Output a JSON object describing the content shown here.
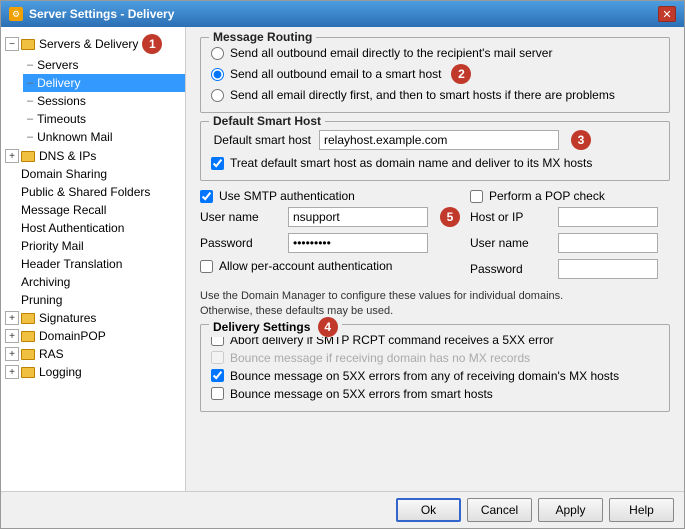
{
  "window": {
    "title": "Server Settings - Delivery",
    "icon": "⚙"
  },
  "sidebar": {
    "sections": [
      {
        "id": "servers-delivery",
        "label": "Servers & Delivery",
        "expanded": true,
        "badge": "1",
        "children": [
          {
            "id": "servers",
            "label": "Servers"
          },
          {
            "id": "delivery",
            "label": "Delivery",
            "selected": true
          },
          {
            "id": "sessions",
            "label": "Sessions"
          },
          {
            "id": "timeouts",
            "label": "Timeouts"
          },
          {
            "id": "unknown-mail",
            "label": "Unknown Mail"
          }
        ]
      },
      {
        "id": "dns-ips",
        "label": "DNS & IPs",
        "expanded": false
      },
      {
        "id": "domain-sharing",
        "label": "Domain Sharing",
        "expanded": false,
        "noExpand": true
      },
      {
        "id": "public-shared-folders",
        "label": "Public & Shared Folders",
        "expanded": false,
        "noExpand": true
      },
      {
        "id": "message-recall",
        "label": "Message Recall",
        "expanded": false,
        "noExpand": true
      },
      {
        "id": "host-authentication",
        "label": "Host Authentication",
        "expanded": false,
        "noExpand": true
      },
      {
        "id": "priority-mail",
        "label": "Priority Mail",
        "expanded": false,
        "noExpand": true
      },
      {
        "id": "header-translation",
        "label": "Header Translation",
        "expanded": false,
        "noExpand": true
      },
      {
        "id": "archiving",
        "label": "Archiving",
        "expanded": false,
        "noExpand": true
      },
      {
        "id": "pruning",
        "label": "Pruning",
        "expanded": false,
        "noExpand": true
      },
      {
        "id": "signatures",
        "label": "Signatures",
        "expanded": false
      },
      {
        "id": "domainpop",
        "label": "DomainPOP",
        "expanded": false
      },
      {
        "id": "ras",
        "label": "RAS",
        "expanded": false
      },
      {
        "id": "logging",
        "label": "Logging",
        "expanded": false
      }
    ]
  },
  "main": {
    "message_routing": {
      "label": "Message Routing",
      "options": [
        {
          "id": "direct",
          "label": "Send all outbound email directly to the recipient's mail server",
          "checked": false
        },
        {
          "id": "smart",
          "label": "Send all outbound email to a smart host",
          "checked": true,
          "badge": "2"
        },
        {
          "id": "smart-fallback",
          "label": "Send all email directly first, and then to smart hosts if there are problems",
          "checked": false
        }
      ]
    },
    "default_smart_host": {
      "label": "Default Smart Host",
      "field_label": "Default smart host",
      "value": "relayhost.example.com",
      "badge": "3",
      "checkbox_label": "Treat default smart host as domain name and deliver to its MX hosts",
      "checkbox_checked": true
    },
    "smtp_auth": {
      "use_smtp_label": "Use SMTP authentication",
      "use_smtp_checked": true,
      "user_name_label": "User name",
      "user_name_value": "nsupport",
      "password_label": "Password",
      "password_value": "••••••••",
      "allow_per_account_label": "Allow per-account authentication",
      "allow_per_account_checked": false,
      "badge": "5",
      "perform_pop_label": "Perform a POP check",
      "perform_pop_checked": false,
      "host_or_ip_label": "Host or IP",
      "host_or_ip_value": "",
      "user_name_right_label": "User name",
      "user_name_right_value": "",
      "password_right_label": "Password",
      "password_right_value": ""
    },
    "info_text": "Use the Domain Manager to configure these values for individual domains.\nOtherwise, these defaults may be used.",
    "delivery_settings": {
      "label": "Delivery Settings",
      "badge": "4",
      "options": [
        {
          "id": "abort",
          "label": "Abort delivery if SMTP RCPT command receives a  5XX error",
          "checked": false
        },
        {
          "id": "bounce-no-mx",
          "label": "Bounce message if receiving domain has no MX records",
          "checked": false,
          "disabled": true
        },
        {
          "id": "bounce-mx",
          "label": "Bounce message on 5XX errors from any of receiving domain's MX hosts",
          "checked": true
        },
        {
          "id": "bounce-smart",
          "label": "Bounce message on 5XX errors from smart hosts",
          "checked": false
        }
      ]
    }
  },
  "buttons": {
    "ok": "Ok",
    "cancel": "Cancel",
    "apply": "Apply",
    "help": "Help"
  },
  "badges": {
    "1": "1",
    "2": "2",
    "3": "3",
    "4": "4",
    "5": "5"
  }
}
